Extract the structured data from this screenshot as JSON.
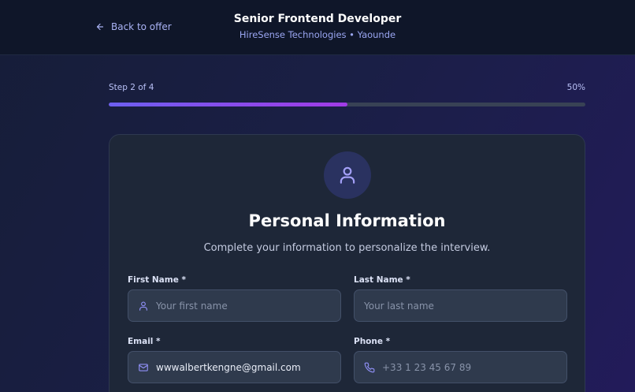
{
  "header": {
    "back_label": "Back to offer",
    "job_title": "Senior Frontend Developer",
    "company_location": "HireSense Technologies • Yaounde"
  },
  "progress": {
    "step_text": "Step 2 of 4",
    "percent_text": "50%",
    "fraction": 0.5
  },
  "card": {
    "icon": "user-icon",
    "title": "Personal Information",
    "subtitle": "Complete your information to personalize the interview."
  },
  "form": {
    "first_name": {
      "label": "First Name *",
      "placeholder": "Your first name",
      "value": "",
      "icon": "user-icon"
    },
    "last_name": {
      "label": "Last Name *",
      "placeholder": "Your last name",
      "value": ""
    },
    "email": {
      "label": "Email *",
      "placeholder": "",
      "value": "wwwalbertkengne@gmail.com",
      "icon": "mail-icon"
    },
    "phone": {
      "label": "Phone *",
      "placeholder": "+33 1 23 45 67 89",
      "value": "",
      "icon": "phone-icon"
    }
  },
  "colors": {
    "accent": "#7b5cf0",
    "progress_start": "#6d5ff0",
    "progress_end": "#a13be6",
    "card_bg": "#1e2738",
    "header_bg": "#0f1629"
  }
}
